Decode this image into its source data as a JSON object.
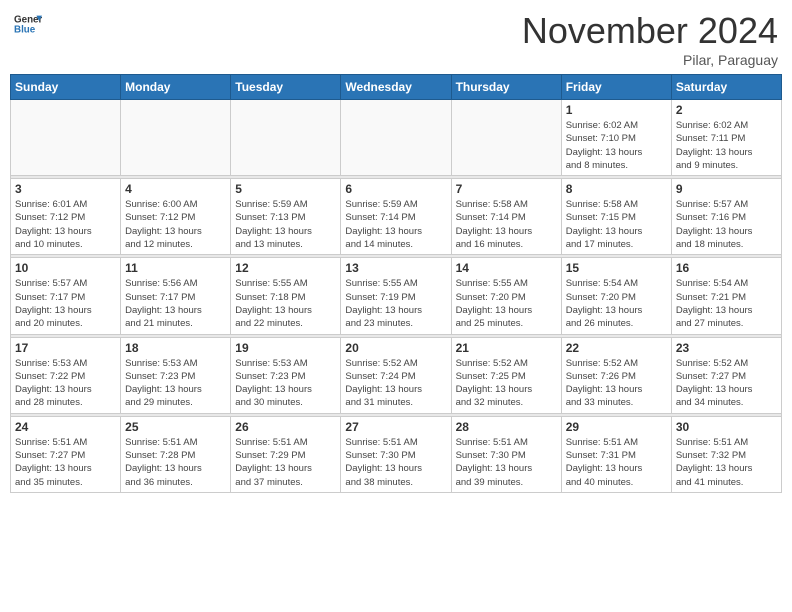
{
  "header": {
    "logo_line1": "General",
    "logo_line2": "Blue",
    "month": "November 2024",
    "location": "Pilar, Paraguay"
  },
  "weekdays": [
    "Sunday",
    "Monday",
    "Tuesday",
    "Wednesday",
    "Thursday",
    "Friday",
    "Saturday"
  ],
  "weeks": [
    [
      {
        "day": "",
        "info": ""
      },
      {
        "day": "",
        "info": ""
      },
      {
        "day": "",
        "info": ""
      },
      {
        "day": "",
        "info": ""
      },
      {
        "day": "",
        "info": ""
      },
      {
        "day": "1",
        "info": "Sunrise: 6:02 AM\nSunset: 7:10 PM\nDaylight: 13 hours\nand 8 minutes."
      },
      {
        "day": "2",
        "info": "Sunrise: 6:02 AM\nSunset: 7:11 PM\nDaylight: 13 hours\nand 9 minutes."
      }
    ],
    [
      {
        "day": "3",
        "info": "Sunrise: 6:01 AM\nSunset: 7:12 PM\nDaylight: 13 hours\nand 10 minutes."
      },
      {
        "day": "4",
        "info": "Sunrise: 6:00 AM\nSunset: 7:12 PM\nDaylight: 13 hours\nand 12 minutes."
      },
      {
        "day": "5",
        "info": "Sunrise: 5:59 AM\nSunset: 7:13 PM\nDaylight: 13 hours\nand 13 minutes."
      },
      {
        "day": "6",
        "info": "Sunrise: 5:59 AM\nSunset: 7:14 PM\nDaylight: 13 hours\nand 14 minutes."
      },
      {
        "day": "7",
        "info": "Sunrise: 5:58 AM\nSunset: 7:14 PM\nDaylight: 13 hours\nand 16 minutes."
      },
      {
        "day": "8",
        "info": "Sunrise: 5:58 AM\nSunset: 7:15 PM\nDaylight: 13 hours\nand 17 minutes."
      },
      {
        "day": "9",
        "info": "Sunrise: 5:57 AM\nSunset: 7:16 PM\nDaylight: 13 hours\nand 18 minutes."
      }
    ],
    [
      {
        "day": "10",
        "info": "Sunrise: 5:57 AM\nSunset: 7:17 PM\nDaylight: 13 hours\nand 20 minutes."
      },
      {
        "day": "11",
        "info": "Sunrise: 5:56 AM\nSunset: 7:17 PM\nDaylight: 13 hours\nand 21 minutes."
      },
      {
        "day": "12",
        "info": "Sunrise: 5:55 AM\nSunset: 7:18 PM\nDaylight: 13 hours\nand 22 minutes."
      },
      {
        "day": "13",
        "info": "Sunrise: 5:55 AM\nSunset: 7:19 PM\nDaylight: 13 hours\nand 23 minutes."
      },
      {
        "day": "14",
        "info": "Sunrise: 5:55 AM\nSunset: 7:20 PM\nDaylight: 13 hours\nand 25 minutes."
      },
      {
        "day": "15",
        "info": "Sunrise: 5:54 AM\nSunset: 7:20 PM\nDaylight: 13 hours\nand 26 minutes."
      },
      {
        "day": "16",
        "info": "Sunrise: 5:54 AM\nSunset: 7:21 PM\nDaylight: 13 hours\nand 27 minutes."
      }
    ],
    [
      {
        "day": "17",
        "info": "Sunrise: 5:53 AM\nSunset: 7:22 PM\nDaylight: 13 hours\nand 28 minutes."
      },
      {
        "day": "18",
        "info": "Sunrise: 5:53 AM\nSunset: 7:23 PM\nDaylight: 13 hours\nand 29 minutes."
      },
      {
        "day": "19",
        "info": "Sunrise: 5:53 AM\nSunset: 7:23 PM\nDaylight: 13 hours\nand 30 minutes."
      },
      {
        "day": "20",
        "info": "Sunrise: 5:52 AM\nSunset: 7:24 PM\nDaylight: 13 hours\nand 31 minutes."
      },
      {
        "day": "21",
        "info": "Sunrise: 5:52 AM\nSunset: 7:25 PM\nDaylight: 13 hours\nand 32 minutes."
      },
      {
        "day": "22",
        "info": "Sunrise: 5:52 AM\nSunset: 7:26 PM\nDaylight: 13 hours\nand 33 minutes."
      },
      {
        "day": "23",
        "info": "Sunrise: 5:52 AM\nSunset: 7:27 PM\nDaylight: 13 hours\nand 34 minutes."
      }
    ],
    [
      {
        "day": "24",
        "info": "Sunrise: 5:51 AM\nSunset: 7:27 PM\nDaylight: 13 hours\nand 35 minutes."
      },
      {
        "day": "25",
        "info": "Sunrise: 5:51 AM\nSunset: 7:28 PM\nDaylight: 13 hours\nand 36 minutes."
      },
      {
        "day": "26",
        "info": "Sunrise: 5:51 AM\nSunset: 7:29 PM\nDaylight: 13 hours\nand 37 minutes."
      },
      {
        "day": "27",
        "info": "Sunrise: 5:51 AM\nSunset: 7:30 PM\nDaylight: 13 hours\nand 38 minutes."
      },
      {
        "day": "28",
        "info": "Sunrise: 5:51 AM\nSunset: 7:30 PM\nDaylight: 13 hours\nand 39 minutes."
      },
      {
        "day": "29",
        "info": "Sunrise: 5:51 AM\nSunset: 7:31 PM\nDaylight: 13 hours\nand 40 minutes."
      },
      {
        "day": "30",
        "info": "Sunrise: 5:51 AM\nSunset: 7:32 PM\nDaylight: 13 hours\nand 41 minutes."
      }
    ]
  ]
}
